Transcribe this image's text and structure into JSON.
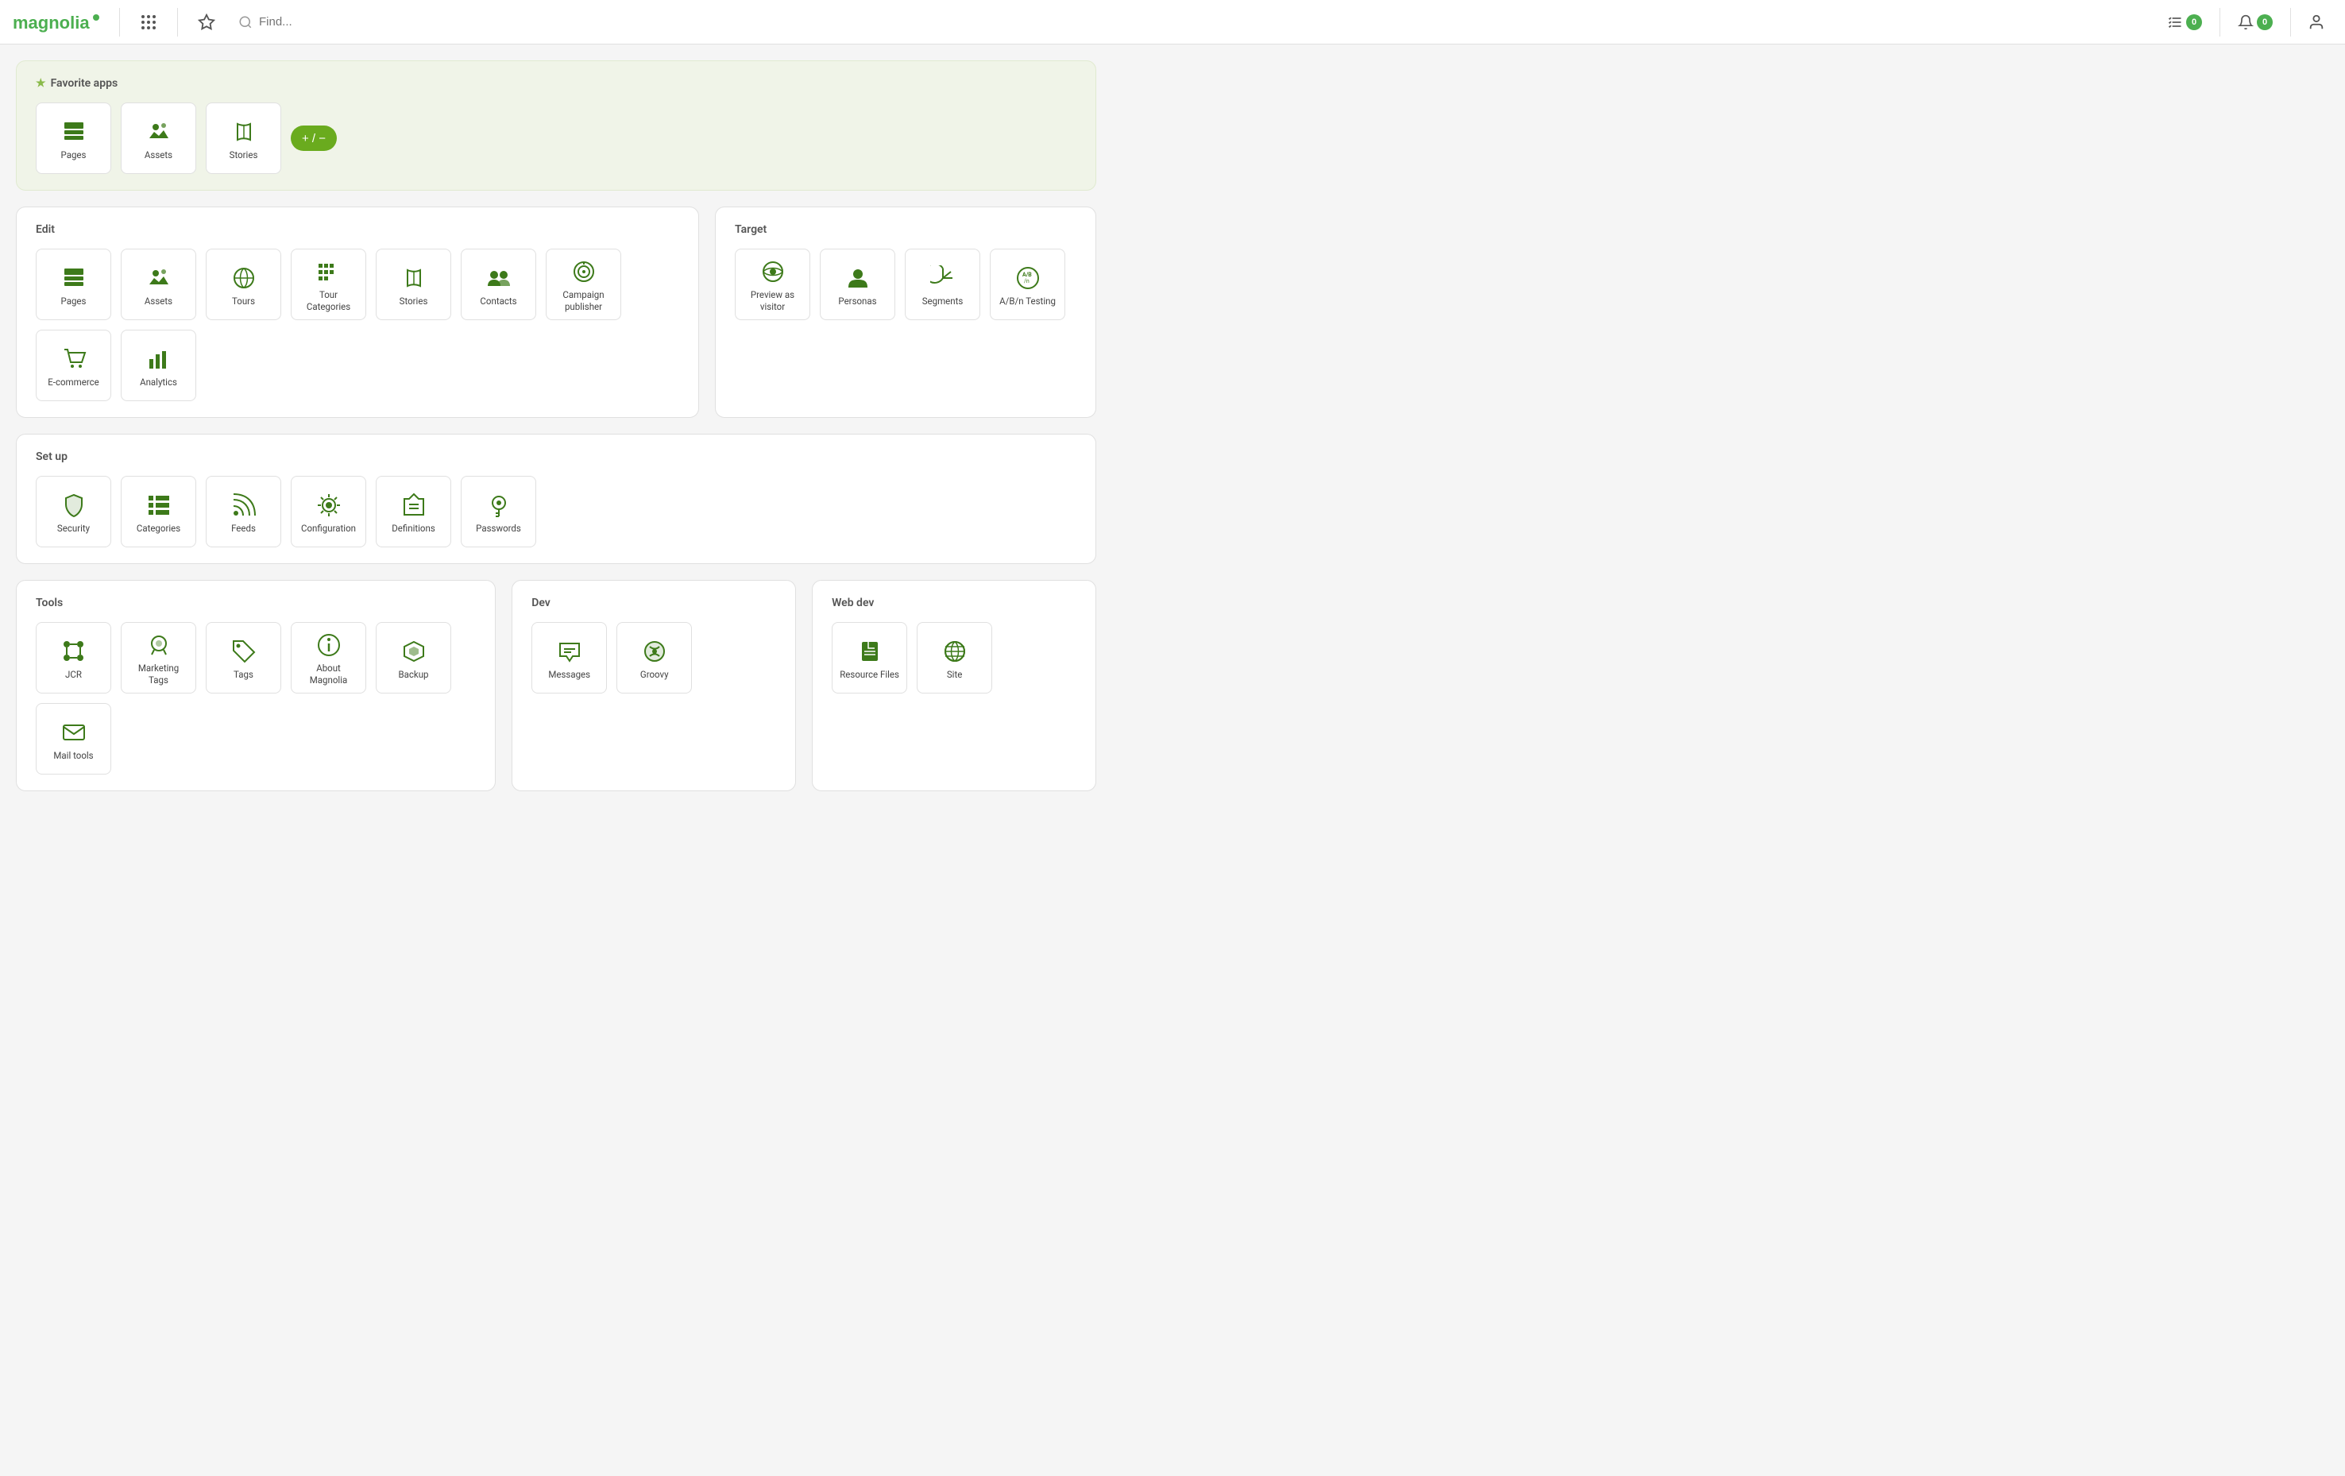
{
  "header": {
    "logo": "magnolia",
    "search_placeholder": "Find...",
    "tasks_label": "Tasks",
    "tasks_count": "0",
    "notifications_label": "Notifications",
    "notifications_count": "0"
  },
  "favorite_apps": {
    "section_title": "Favorite apps",
    "add_remove_label": "+ / −",
    "apps": [
      {
        "id": "pages",
        "label": "Pages",
        "icon": "pages"
      },
      {
        "id": "assets",
        "label": "Assets",
        "icon": "assets"
      },
      {
        "id": "stories",
        "label": "Stories",
        "icon": "stories"
      }
    ]
  },
  "edit_section": {
    "title": "Edit",
    "apps": [
      {
        "id": "pages",
        "label": "Pages",
        "icon": "pages"
      },
      {
        "id": "assets",
        "label": "Assets",
        "icon": "assets"
      },
      {
        "id": "tours",
        "label": "Tours",
        "icon": "tours"
      },
      {
        "id": "tour-categories",
        "label": "Tour Categories",
        "icon": "tour-categories"
      },
      {
        "id": "stories",
        "label": "Stories",
        "icon": "stories"
      },
      {
        "id": "contacts",
        "label": "Contacts",
        "icon": "contacts"
      },
      {
        "id": "campaign-publisher",
        "label": "Campaign publisher",
        "icon": "campaign-publisher"
      },
      {
        "id": "ecommerce",
        "label": "E-commerce",
        "icon": "ecommerce"
      },
      {
        "id": "analytics",
        "label": "Analytics",
        "icon": "analytics"
      }
    ]
  },
  "target_section": {
    "title": "Target",
    "apps": [
      {
        "id": "preview-as-visitor",
        "label": "Preview as visitor",
        "icon": "preview-as-visitor"
      },
      {
        "id": "personas",
        "label": "Personas",
        "icon": "personas"
      },
      {
        "id": "segments",
        "label": "Segments",
        "icon": "segments"
      },
      {
        "id": "abn-testing",
        "label": "A/B/n Testing",
        "icon": "abn-testing"
      }
    ]
  },
  "setup_section": {
    "title": "Set up",
    "apps": [
      {
        "id": "security",
        "label": "Security",
        "icon": "security"
      },
      {
        "id": "categories",
        "label": "Categories",
        "icon": "categories"
      },
      {
        "id": "feeds",
        "label": "Feeds",
        "icon": "feeds"
      },
      {
        "id": "configuration",
        "label": "Configuration",
        "icon": "configuration"
      },
      {
        "id": "definitions",
        "label": "Definitions",
        "icon": "definitions"
      },
      {
        "id": "passwords",
        "label": "Passwords",
        "icon": "passwords"
      }
    ]
  },
  "tools_section": {
    "title": "Tools",
    "apps": [
      {
        "id": "jcr",
        "label": "JCR",
        "icon": "jcr"
      },
      {
        "id": "marketing-tags",
        "label": "Marketing Tags",
        "icon": "marketing-tags"
      },
      {
        "id": "tags",
        "label": "Tags",
        "icon": "tags"
      },
      {
        "id": "about-magnolia",
        "label": "About Magnolia",
        "icon": "about-magnolia"
      },
      {
        "id": "backup",
        "label": "Backup",
        "icon": "backup"
      },
      {
        "id": "mail-tools",
        "label": "Mail tools",
        "icon": "mail-tools"
      }
    ]
  },
  "dev_section": {
    "title": "Dev",
    "apps": [
      {
        "id": "messages",
        "label": "Messages",
        "icon": "messages"
      },
      {
        "id": "groovy",
        "label": "Groovy",
        "icon": "groovy"
      }
    ]
  },
  "webdev_section": {
    "title": "Web dev",
    "apps": [
      {
        "id": "resource-files",
        "label": "Resource Files",
        "icon": "resource-files"
      },
      {
        "id": "site",
        "label": "Site",
        "icon": "site"
      }
    ]
  }
}
